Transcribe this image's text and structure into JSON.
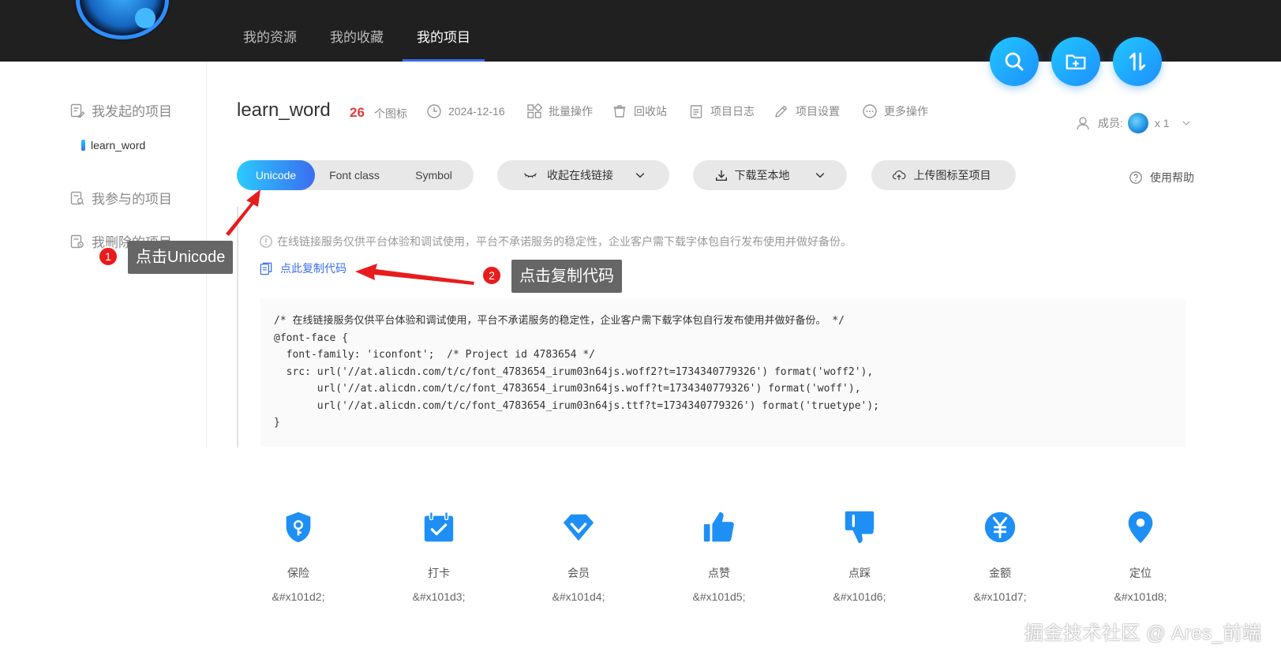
{
  "nav": {
    "items": [
      "我的资源",
      "我的收藏",
      "我的项目"
    ],
    "active_index": 2
  },
  "fabs": {
    "search_icon": "search-icon",
    "add_folder_icon": "folder-plus-icon",
    "sort_icon": "sort-icon"
  },
  "sidebar": {
    "initiated": "我发起的项目",
    "initiated_item": "learn_word",
    "joined": "我参与的项目",
    "deleted": "我删除的项目"
  },
  "project": {
    "title": "learn_word",
    "icon_count": "26",
    "icon_count_unit": "个图标",
    "date": "2024-12-16",
    "batch": "批量操作",
    "recycle": "回收站",
    "log": "项目日志",
    "settings": "项目设置",
    "more": "更多操作",
    "members_label": "成员:",
    "members_count": "x 1"
  },
  "toolbar": {
    "tabs": [
      "Unicode",
      "Font class",
      "Symbol"
    ],
    "active_tab": 0,
    "collapse_link": "收起在线链接",
    "download": "下载至本地",
    "upload": "上传图标至项目",
    "help": "使用帮助"
  },
  "notice": "在线链接服务仅供平台体验和调试使用，平台不承诺服务的稳定性，企业客户需下载字体包自行发布使用并做好备份。",
  "copy_link": "点此复制代码",
  "code": "/* 在线链接服务仅供平台体验和调试使用，平台不承诺服务的稳定性，企业客户需下载字体包自行发布使用并做好备份。 */\n@font-face {\n  font-family: 'iconfont';  /* Project id 4783654 */\n  src: url('//at.alicdn.com/t/c/font_4783654_irum03n64js.woff2?t=1734340779326') format('woff2'),\n       url('//at.alicdn.com/t/c/font_4783654_irum03n64js.woff?t=1734340779326') format('woff'),\n       url('//at.alicdn.com/t/c/font_4783654_irum03n64js.ttf?t=1734340779326') format('truetype');\n}",
  "icons": [
    {
      "name": "保险",
      "code": "&#x101d2;",
      "icon": "insurance-icon"
    },
    {
      "name": "打卡",
      "code": "&#x101d3;",
      "icon": "check-in-icon"
    },
    {
      "name": "会员",
      "code": "&#x101d4;",
      "icon": "member-icon"
    },
    {
      "name": "点赞",
      "code": "&#x101d5;",
      "icon": "thumbs-up-icon"
    },
    {
      "name": "点踩",
      "code": "&#x101d6;",
      "icon": "thumbs-down-icon"
    },
    {
      "name": "金额",
      "code": "&#x101d7;",
      "icon": "yen-icon"
    },
    {
      "name": "定位",
      "code": "&#x101d8;",
      "icon": "location-icon"
    }
  ],
  "annotations": {
    "step1_number": "1",
    "step1_text": "点击Unicode",
    "step2_number": "2",
    "step2_text": "点击复制代码"
  },
  "watermark": "掘金技术社区 @ Ares_前端",
  "colors": {
    "accent": "#3a6df0",
    "accent_light": "#2bcbff",
    "icon_blue": "#1e8ff5",
    "count_red": "#e5393c",
    "topbar": "#202020"
  }
}
